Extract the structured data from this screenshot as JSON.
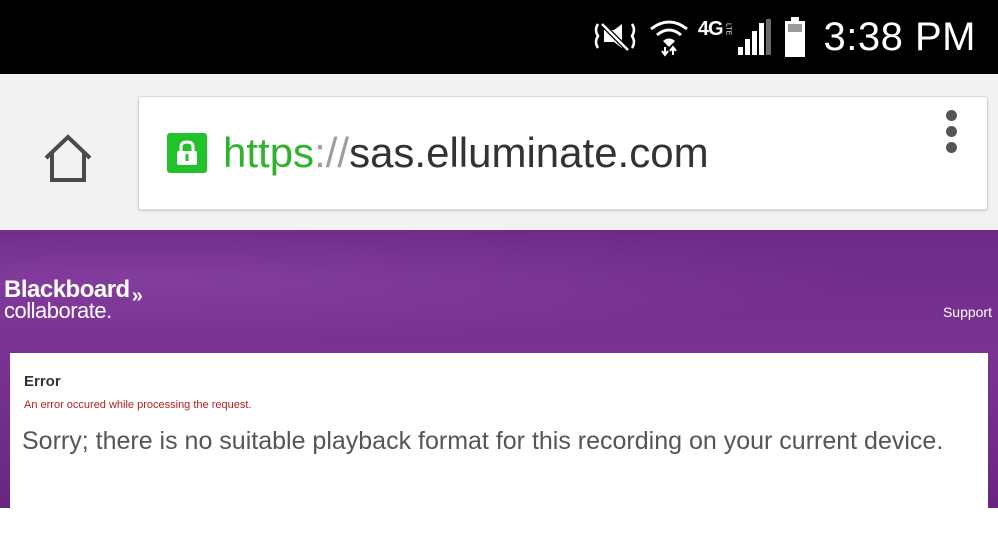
{
  "status_bar": {
    "time": "3:38 PM",
    "network_label": "4G",
    "network_sub": "LTE",
    "icons": [
      "mute-icon",
      "wifi-icon",
      "signal-icon",
      "battery-icon"
    ]
  },
  "browser": {
    "url_scheme": "https",
    "url_separator": "://",
    "url_host": "sas.elluminate.com",
    "icons": [
      "home-icon",
      "lock-icon",
      "more-vert-icon"
    ],
    "secure_color": "#22c32a"
  },
  "banner": {
    "logo_line1": "Blackboard",
    "logo_chevron": "»",
    "logo_line2": "collaborate",
    "logo_tm": ".",
    "support_label": "Support",
    "background_color": "#7a3394"
  },
  "error": {
    "title": "Error",
    "subtitle": "An error occured while processing the request.",
    "message": "Sorry; there is no suitable playback format for this recording on your current device.",
    "subtitle_color": "#b5201e"
  }
}
